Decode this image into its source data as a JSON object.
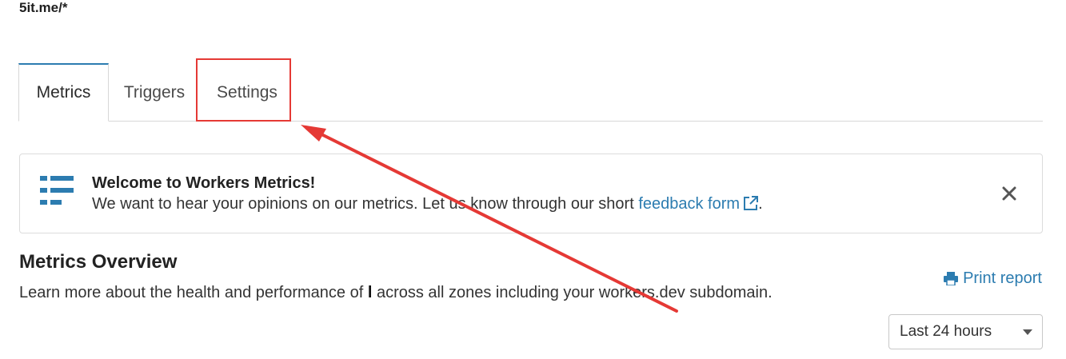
{
  "route": "5it.me/*",
  "tabs": [
    {
      "label": "Metrics"
    },
    {
      "label": "Triggers"
    },
    {
      "label": "Settings"
    }
  ],
  "banner": {
    "title": "Welcome to Workers Metrics!",
    "text_before": "We want to hear your opinions on our metrics. Let us know through our short ",
    "link": "feedback form",
    "text_after": "."
  },
  "overview": {
    "title": "Metrics Overview",
    "desc_before": "Learn more about the health and performance of ",
    "desc_bold": "l",
    "desc_after": " across all zones including your workers.dev subdomain."
  },
  "print_report": "Print report",
  "time_range": {
    "selected": "Last 24 hours"
  },
  "colors": {
    "accent": "#2c7cb0",
    "annotation": "#e53935"
  },
  "icons": [
    "list-icon",
    "external-link-icon",
    "close-icon",
    "printer-icon",
    "chevron-down-icon"
  ]
}
